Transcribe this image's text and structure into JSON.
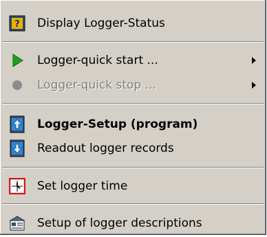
{
  "menu": {
    "items": [
      {
        "label": "Display Logger-Status",
        "icon": "logger-status-icon",
        "enabled": true
      },
      {
        "label": "Logger-quick start ...",
        "icon": "play-triangle-icon",
        "submenu": true,
        "enabled": true
      },
      {
        "label": "Logger-quick stop ...",
        "icon": "stop-circle-icon",
        "submenu": true,
        "enabled": false
      },
      {
        "label": "Logger-Setup (program)",
        "icon": "logger-upload-icon",
        "default": true,
        "enabled": true
      },
      {
        "label": "Readout logger records",
        "icon": "logger-download-icon",
        "enabled": true
      },
      {
        "label": "Set logger time",
        "icon": "clock-icon",
        "enabled": true
      },
      {
        "label": "Setup of logger descriptions",
        "icon": "descriptions-icon",
        "enabled": true
      }
    ]
  },
  "colors": {
    "menu_bg": "#d4d0c8",
    "disabled_text": "#808080",
    "play_green": "#1fa01f",
    "icon_blue": "#2a88e0"
  }
}
